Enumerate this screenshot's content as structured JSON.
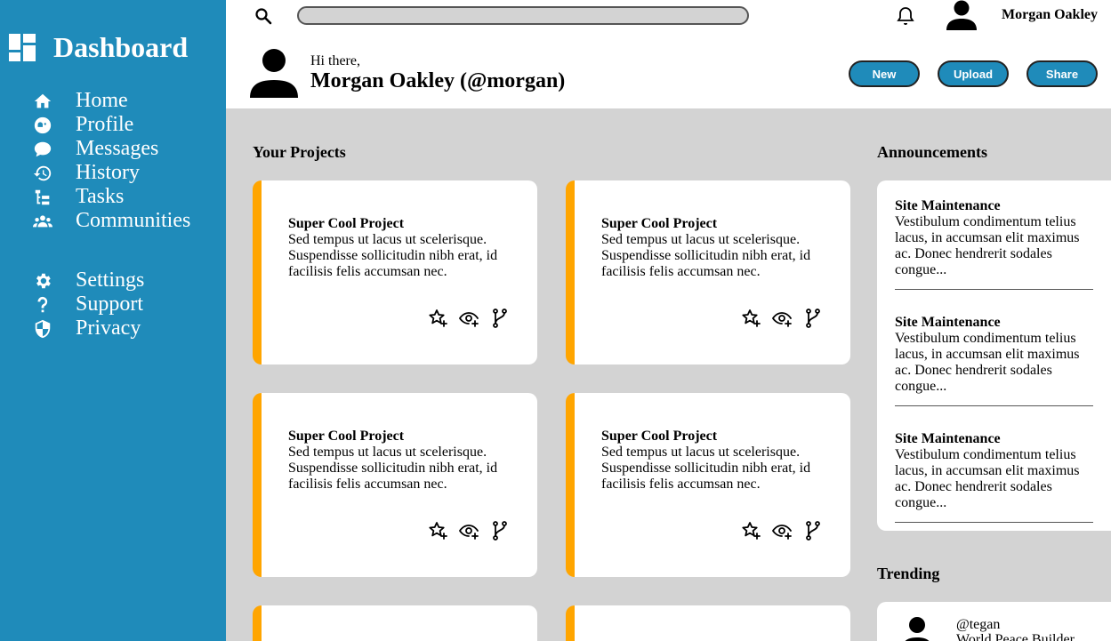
{
  "sidebar": {
    "brand": "Dashboard",
    "items": [
      {
        "label": "Home",
        "icon": "home-icon"
      },
      {
        "label": "Profile",
        "icon": "profile-icon"
      },
      {
        "label": "Messages",
        "icon": "chat-icon"
      },
      {
        "label": "History",
        "icon": "history-icon"
      },
      {
        "label": "Tasks",
        "icon": "tasks-icon"
      },
      {
        "label": "Communities",
        "icon": "communities-icon"
      }
    ],
    "secondary": [
      {
        "label": "Settings",
        "icon": "gear-icon"
      },
      {
        "label": "Support",
        "icon": "question-icon"
      },
      {
        "label": "Privacy",
        "icon": "shield-icon"
      }
    ]
  },
  "header": {
    "search_placeholder": "",
    "username": "Morgan Oakley",
    "greeting": "Hi there,",
    "full_name": "Morgan Oakley (@morgan)",
    "buttons": {
      "new": "New",
      "upload": "Upload",
      "share": "Share"
    }
  },
  "projects": {
    "title": "Your Projects",
    "cards": [
      {
        "title": "Super Cool Project",
        "text": "Sed tempus ut lacus ut scelerisque. Suspendisse sollicitudin nibh erat, id facilisis felis accumsan nec."
      },
      {
        "title": "Super Cool Project",
        "text": "Sed tempus ut lacus ut scelerisque. Suspendisse sollicitudin nibh erat, id facilisis felis accumsan nec."
      },
      {
        "title": "Super Cool Project",
        "text": "Sed tempus ut lacus ut scelerisque. Suspendisse sollicitudin nibh erat, id facilisis felis accumsan nec."
      },
      {
        "title": "Super Cool Project",
        "text": "Sed tempus ut lacus ut scelerisque. Suspendisse sollicitudin nibh erat, id facilisis felis accumsan nec."
      }
    ]
  },
  "announcements": {
    "title": "Announcements",
    "items": [
      {
        "title": "Site Maintenance",
        "text": "Vestibulum condimentum telius lacus, in accumsan elit maximus ac. Donec hendrerit sodales congue..."
      },
      {
        "title": "Site Maintenance",
        "text": "Vestibulum condimentum telius lacus, in accumsan elit maximus ac. Donec hendrerit sodales congue..."
      },
      {
        "title": "Site Maintenance",
        "text": "Vestibulum condimentum telius lacus, in accumsan elit maximus ac. Donec hendrerit sodales congue..."
      }
    ]
  },
  "trending": {
    "title": "Trending",
    "items": [
      {
        "handle": "@tegan",
        "desc": "World Peace Builder"
      }
    ]
  },
  "colors": {
    "sidebar": "#1f8bba",
    "accent": "#ffa500",
    "background": "#d3d3d3"
  }
}
